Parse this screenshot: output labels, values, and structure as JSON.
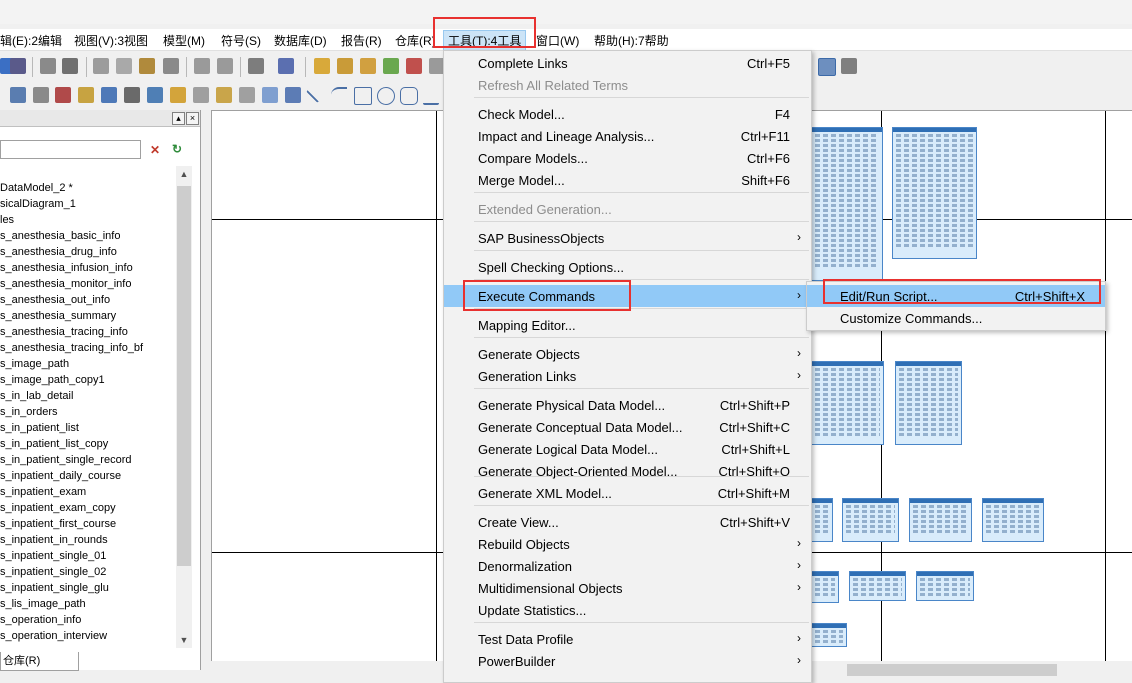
{
  "menubar": {
    "items": [
      {
        "label": "辑(E):2编辑"
      },
      {
        "label": "视图(V):3视图"
      },
      {
        "label": "模型(M)"
      },
      {
        "label": "符号(S)"
      },
      {
        "label": "数据库(D)"
      },
      {
        "label": "报告(R)"
      },
      {
        "label": "仓库(R)"
      },
      {
        "label": "工具(T):4工具"
      },
      {
        "label": "窗口(W)"
      },
      {
        "label": "帮助(H):7帮助"
      }
    ]
  },
  "browser": {
    "tree": [
      "DataModel_2 *",
      "sicalDiagram_1",
      "les",
      "s_anesthesia_basic_info",
      "s_anesthesia_drug_info",
      "s_anesthesia_infusion_info",
      "s_anesthesia_monitor_info",
      "s_anesthesia_out_info",
      "s_anesthesia_summary",
      "s_anesthesia_tracing_info",
      "s_anesthesia_tracing_info_bf",
      "s_image_path",
      "s_image_path_copy1",
      "s_in_lab_detail",
      "s_in_orders",
      "s_in_patient_list",
      "s_in_patient_list_copy",
      "s_in_patient_single_record",
      "s_inpatient_daily_course",
      "s_inpatient_exam",
      "s_inpatient_exam_copy",
      "s_inpatient_first_course",
      "s_inpatient_in_rounds",
      "s_inpatient_single_01",
      "s_inpatient_single_02",
      "s_inpatient_single_glu",
      "s_lis_image_path",
      "s_operation_info",
      "s_operation_interview"
    ],
    "bottom_tab": "仓库(R)"
  },
  "tools_menu": {
    "items": [
      {
        "label": "Complete Links",
        "shortcut": "Ctrl+F5",
        "disabled": false,
        "submenu": false
      },
      {
        "label": "Refresh All Related Terms",
        "shortcut": "",
        "disabled": true,
        "submenu": false
      },
      {
        "label": "Check Model...",
        "shortcut": "F4",
        "disabled": false,
        "submenu": false
      },
      {
        "label": "Impact and Lineage Analysis...",
        "shortcut": "Ctrl+F11",
        "disabled": false,
        "submenu": false
      },
      {
        "label": "Compare Models...",
        "shortcut": "Ctrl+F6",
        "disabled": false,
        "submenu": false
      },
      {
        "label": "Merge Model...",
        "shortcut": "Shift+F6",
        "disabled": false,
        "submenu": false
      },
      {
        "label": "Extended Generation...",
        "shortcut": "",
        "disabled": true,
        "submenu": false
      },
      {
        "label": "SAP BusinessObjects",
        "shortcut": "",
        "disabled": false,
        "submenu": true
      },
      {
        "label": "Spell Checking Options...",
        "shortcut": "",
        "disabled": false,
        "submenu": false
      },
      {
        "label": "Execute Commands",
        "shortcut": "",
        "disabled": false,
        "submenu": true
      },
      {
        "label": "Mapping Editor...",
        "shortcut": "",
        "disabled": false,
        "submenu": false
      },
      {
        "label": "Generate Objects",
        "shortcut": "",
        "disabled": false,
        "submenu": true
      },
      {
        "label": "Generation Links",
        "shortcut": "",
        "disabled": false,
        "submenu": true
      },
      {
        "label": "Generate Physical Data Model...",
        "shortcut": "Ctrl+Shift+P",
        "disabled": false,
        "submenu": false
      },
      {
        "label": "Generate Conceptual Data Model...",
        "shortcut": "Ctrl+Shift+C",
        "disabled": false,
        "submenu": false
      },
      {
        "label": "Generate Logical Data Model...",
        "shortcut": "Ctrl+Shift+L",
        "disabled": false,
        "submenu": false
      },
      {
        "label": "Generate Object-Oriented Model...",
        "shortcut": "Ctrl+Shift+O",
        "disabled": false,
        "submenu": false
      },
      {
        "label": "Generate XML Model...",
        "shortcut": "Ctrl+Shift+M",
        "disabled": false,
        "submenu": false
      },
      {
        "label": "Create View...",
        "shortcut": "Ctrl+Shift+V",
        "disabled": false,
        "submenu": false
      },
      {
        "label": "Rebuild Objects",
        "shortcut": "",
        "disabled": false,
        "submenu": true
      },
      {
        "label": "Denormalization",
        "shortcut": "",
        "disabled": false,
        "submenu": true
      },
      {
        "label": "Multidimensional Objects",
        "shortcut": "",
        "disabled": false,
        "submenu": true
      },
      {
        "label": "Update Statistics...",
        "shortcut": "",
        "disabled": false,
        "submenu": false
      },
      {
        "label": "Test Data Profile",
        "shortcut": "",
        "disabled": false,
        "submenu": true
      },
      {
        "label": "PowerBuilder",
        "shortcut": "",
        "disabled": false,
        "submenu": true
      }
    ]
  },
  "execute_submenu": {
    "items": [
      {
        "label": "Edit/Run Script...",
        "shortcut": "Ctrl+Shift+X"
      },
      {
        "label": "Customize Commands...",
        "shortcut": ""
      }
    ]
  },
  "colors": {
    "highlight": "#91c9f7",
    "annotation_red": "#e8312f",
    "entity_fill": "#d9ecfb",
    "entity_border": "#4a86c8"
  }
}
